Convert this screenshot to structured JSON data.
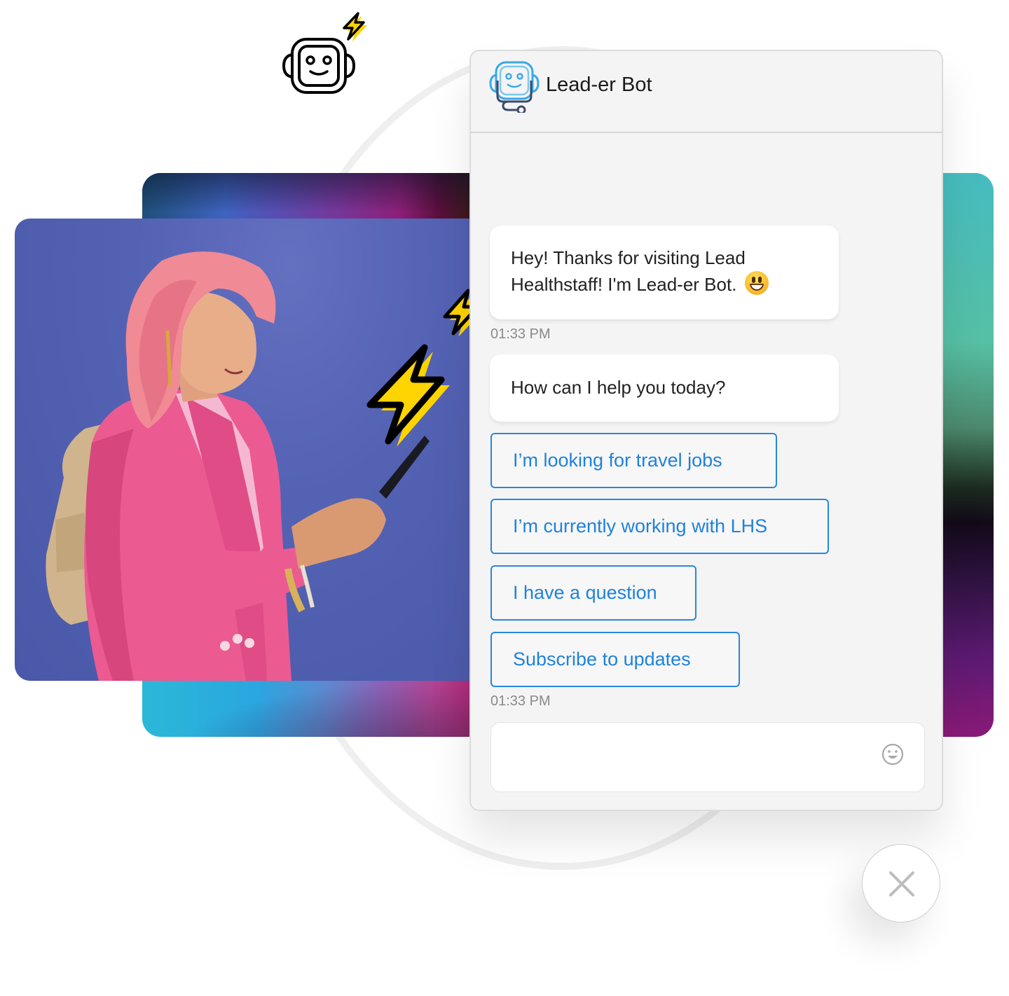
{
  "chat": {
    "title": "Lead-er Bot",
    "messages": [
      {
        "text": "Hey! Thanks for visiting Lead Healthstaff! I'm Lead-er Bot.",
        "emoji": "grinning-face-emoji",
        "time": "01:33 PM"
      },
      {
        "text": "How can I help you today?"
      }
    ],
    "quick_replies": [
      "I’m looking for travel jobs",
      "I’m currently working with LHS",
      "I have a question",
      "Subscribe to updates"
    ],
    "quick_replies_time": "01:33 PM",
    "composer": {
      "value": "",
      "placeholder": ""
    }
  },
  "icons": {
    "header_logo": "robot-stethoscope-icon",
    "emoji_button": "smiley-icon",
    "close_button": "close-icon",
    "decor_robot": "robot-face-icon",
    "decor_bolts": [
      "lightning-bolt-icon",
      "lightning-bolt-icon",
      "lightning-bolt-icon"
    ]
  },
  "colors": {
    "accent_blue": "#1f82dc",
    "chat_bg": "#f4f4f4",
    "bolt_yellow": "#ffd400",
    "photo_bg": "#5462b4",
    "timestamp_gray": "#8a8a8a"
  }
}
